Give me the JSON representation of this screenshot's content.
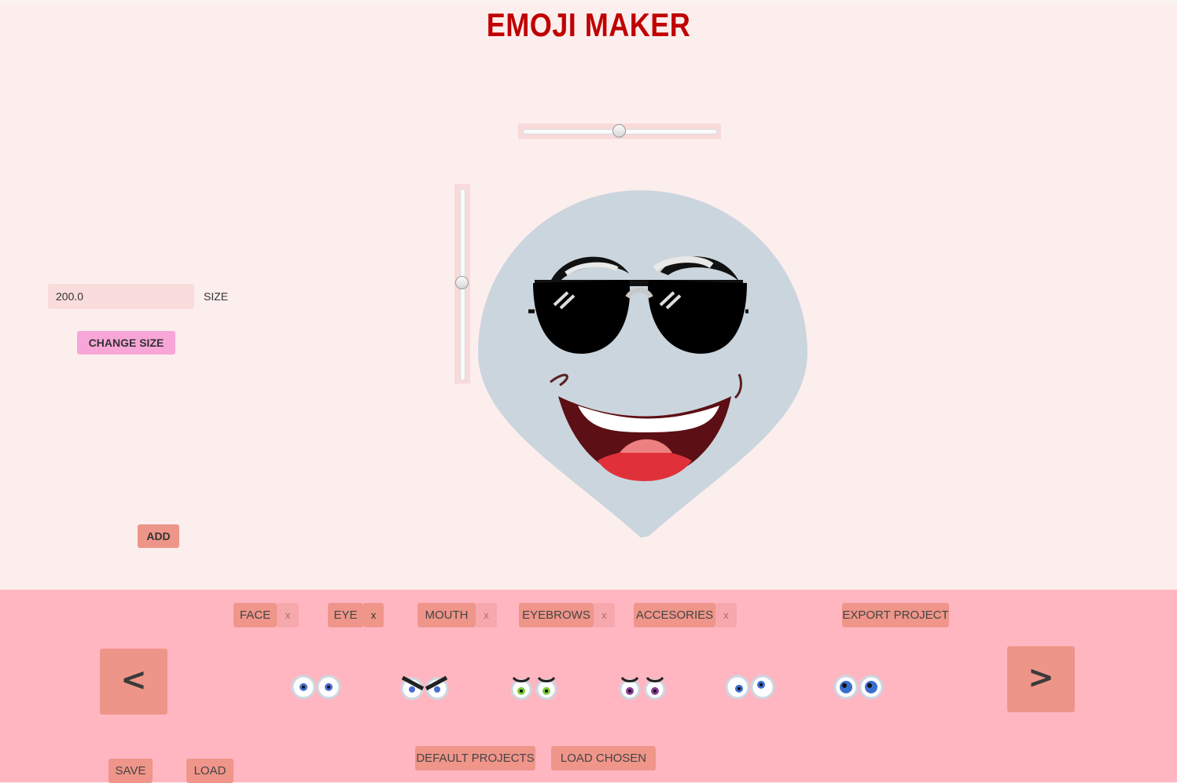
{
  "app": {
    "title": "EMOJI MAKER"
  },
  "sliders": {
    "horizontal_value": 0.5,
    "vertical_value": 0.5
  },
  "size_control": {
    "value": "200.0",
    "label": "SIZE",
    "change_button": "CHANGE SIZE"
  },
  "add_button": "ADD",
  "emoji": {
    "face_color": "#cbd5dd",
    "face": "teardrop",
    "eyes": "sunglasses",
    "mouth": "big-smile"
  },
  "categories": [
    {
      "label": "FACE",
      "close": "x"
    },
    {
      "label": "EYE",
      "close": "x"
    },
    {
      "label": "MOUTH",
      "close": "x"
    },
    {
      "label": "EYEBROWS",
      "close": "x"
    },
    {
      "label": "ACCESORIES",
      "close": "x"
    }
  ],
  "export_button": "EXPORT PROJECT",
  "navigation": {
    "prev": "<",
    "next": ">"
  },
  "eye_options": [
    {
      "name": "eyes-blue-round",
      "iris": "#4a6fd0"
    },
    {
      "name": "eyes-angry",
      "iris": "#4a6fd0"
    },
    {
      "name": "eyes-green-lashes",
      "iris": "#7ccc3a"
    },
    {
      "name": "eyes-purple-lashes",
      "iris": "#8a3a9a"
    },
    {
      "name": "eyes-blue-side",
      "iris": "#3a6fd0"
    },
    {
      "name": "eyes-large-blue",
      "iris": "#3a6fd0"
    }
  ],
  "footer": {
    "save": "SAVE",
    "load": "LOAD",
    "default_projects": "DEFAULT PROJECTS",
    "load_chosen": "LOAD CHOSEN"
  },
  "colors": {
    "title": "#c00000",
    "background": "#fdeeee",
    "panel": "#ffb6c1",
    "button": "#ef9589",
    "accent_button": "#f8a6d8"
  }
}
